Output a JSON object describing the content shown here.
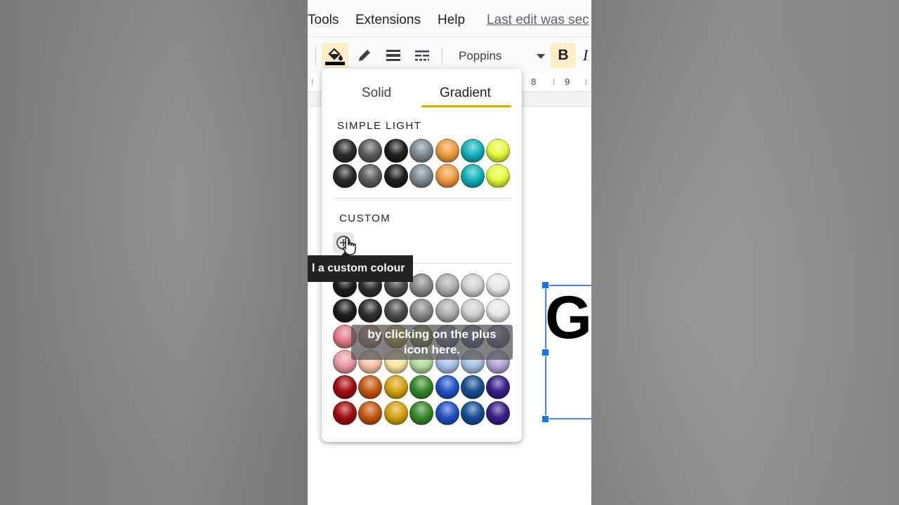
{
  "menubar": {
    "items": [
      "Tools",
      "Extensions",
      "Help"
    ],
    "last_edit": "Last edit was sec"
  },
  "toolbar": {
    "icons": [
      "fill-color-icon",
      "pen-icon",
      "border-weight-icon",
      "border-dash-icon"
    ],
    "fill_color": "#000000",
    "font": "Poppins",
    "bold_label": "B",
    "italic_label": "I"
  },
  "ruler": {
    "labels": [
      "8",
      "9"
    ]
  },
  "document": {
    "big_letter": "G"
  },
  "popup": {
    "tabs": [
      {
        "label": "Solid",
        "active": false
      },
      {
        "label": "Gradient",
        "active": true
      }
    ],
    "simple_light_label": "SIMPLE LIGHT",
    "custom_label": "CUSTOM",
    "add_custom_tooltip": "l a custom colour",
    "simple_light_rows": [
      [
        "#2a2a2a",
        "#5c5c5c",
        "#1e1e1e",
        "#7e8a93",
        "#f09a3e",
        "#10b3b8",
        "#e6fb3a"
      ],
      [
        "#2a2a2a",
        "#5c5c5c",
        "#1e1e1e",
        "#7e8a93",
        "#f09a3e",
        "#10b3b8",
        "#e6fb3a"
      ]
    ],
    "palette_rows": [
      [
        "#1c1c1c",
        "#2e2e2e",
        "#4a4a4a",
        "#8a8a8a",
        "#adadad",
        "#cfcfcf",
        "#e7e7e7"
      ],
      [
        "#1c1c1c",
        "#2e2e2e",
        "#4a4a4a",
        "#8a8a8a",
        "#adadad",
        "#cfcfcf",
        "#e7e7e7"
      ],
      [
        "#e07a85",
        "#c8906a",
        "#d4b04a",
        "#7d9e5e",
        "#6a86b8",
        "#5c6f9c",
        "#7b6a9c"
      ],
      [
        "#e79aa1",
        "#f6c7a3",
        "#fbe79e",
        "#b7dd9f",
        "#a9c4f0",
        "#a5c4e6",
        "#b5a6dd"
      ],
      [
        "#a50d12",
        "#c6570f",
        "#d6a20d",
        "#34892a",
        "#1f53c6",
        "#164f96",
        "#3a1e8a"
      ],
      [
        "#a50d12",
        "#c6570f",
        "#d6a20d",
        "#34892a",
        "#1f53c6",
        "#164f96",
        "#3a1e8a"
      ]
    ]
  },
  "caption": {
    "line1": "by clicking on the plus",
    "line2": "icon here."
  }
}
